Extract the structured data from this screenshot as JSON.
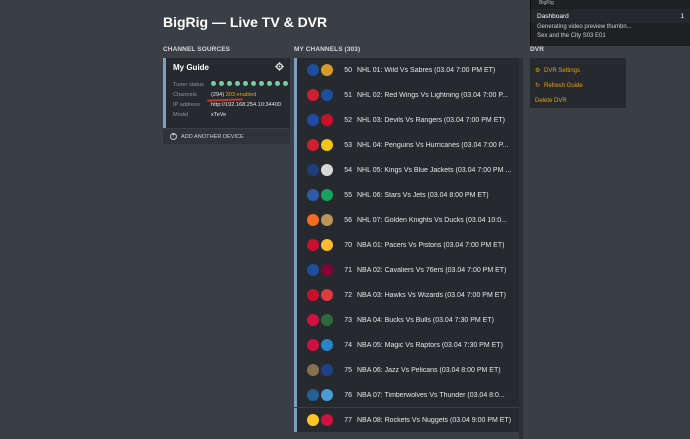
{
  "page_title": "BigRig — Live TV & DVR",
  "sections": {
    "sources": "CHANNEL SOURCES",
    "channels": "MY CHANNELS (303)",
    "dvr": "DVR"
  },
  "notifications": {
    "server": "BigRig",
    "dashboard_label": "Dashboard",
    "badge": "1",
    "message_line1": "Generating video preview thumbn...",
    "message_line2": "Sex and the City S03 E01"
  },
  "guide": {
    "title": "My Guide",
    "tuner_label": "Tuner status",
    "channels_label": "Channels",
    "channels_count": "(294)",
    "channels_enabled": "303 enabled",
    "ip_label": "IP address",
    "ip_value": "http://192.168.254.10:34400",
    "model_label": "Model",
    "model_value": "xTeVe"
  },
  "add_device_label": "ADD ANOTHER DEVICE",
  "channels": [
    {
      "num": "50",
      "name": "NHL 01: Wild Vs Sabres (03.04 7:00 PM ET)",
      "c1": "#1c4f9e",
      "c2": "#d69a2a"
    },
    {
      "num": "51",
      "name": "NHL 02: Red Wings Vs Lightning (03.04 7:00 P...",
      "c1": "#cc1f2f",
      "c2": "#1d4e9a"
    },
    {
      "num": "52",
      "name": "NHL 03: Devils Vs Rangers (03.04 7:00 PM ET)",
      "c1": "#1f4aa6",
      "c2": "#c8102e"
    },
    {
      "num": "53",
      "name": "NHL 04: Penguins Vs Hurricanes (03.04 7:00 P...",
      "c1": "#cf1f2e",
      "c2": "#f0c419"
    },
    {
      "num": "54",
      "name": "NHL 05: Kings Vs Blue Jackets (03.04 7:00 PM ...",
      "c1": "#1f3d7a",
      "c2": "#d8d8d8"
    },
    {
      "num": "55",
      "name": "NHL 06: Stars Vs Jets (03.04 8:00 PM ET)",
      "c1": "#2f5aa8",
      "c2": "#19a35a"
    },
    {
      "num": "56",
      "name": "NHL 07: Golden Knights Vs Ducks (03.04 10:0...",
      "c1": "#f26b21",
      "c2": "#b9975b"
    },
    {
      "num": "70",
      "name": "NBA 01: Pacers Vs Pistons (03.04 7:00 PM ET)",
      "c1": "#c8102e",
      "c2": "#fdbb30"
    },
    {
      "num": "71",
      "name": "NBA 02: Cavaliers Vs 76ers (03.04 7:00 PM ET)",
      "c1": "#1d4f9e",
      "c2": "#860038"
    },
    {
      "num": "72",
      "name": "NBA 03: Hawks Vs Wizards (03.04 7:00 PM ET)",
      "c1": "#c8102e",
      "c2": "#e03a3e"
    },
    {
      "num": "73",
      "name": "NBA 04: Bucks Vs Bulls (03.04 7:30 PM ET)",
      "c1": "#ce1141",
      "c2": "#2e6b3a"
    },
    {
      "num": "74",
      "name": "NBA 05: Magic Vs Raptors (03.04 7:30 PM ET)",
      "c1": "#ce1141",
      "c2": "#2a84c9"
    },
    {
      "num": "75",
      "name": "NBA 06: Jazz Vs Pelicans (03.04 8:00 PM ET)",
      "c1": "#85714d",
      "c2": "#1d428a"
    },
    {
      "num": "76",
      "name": "NBA 07: Timberwolves Vs Thunder (03.04 8:0...",
      "c1": "#236192",
      "c2": "#4b9cd3"
    },
    {
      "num": "77",
      "name": "NBA 08: Rockets Vs Nuggets (03.04 9:00 PM ET)",
      "c1": "#fec524",
      "c2": "#ce1141"
    }
  ],
  "dvr": {
    "settings": "DVR Settings",
    "refresh": "Refresh Guide",
    "delete": "Delete DVR"
  },
  "colors": {
    "accent": "#e5a00d",
    "tuner_ok": "#6fd39a",
    "card_border": "#7d9fc0"
  }
}
